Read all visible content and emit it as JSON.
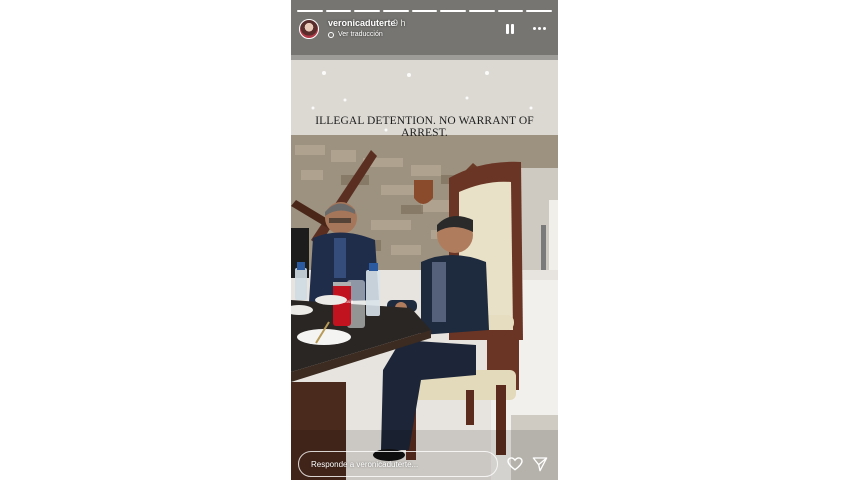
{
  "story": {
    "username": "veronicaduterte",
    "time_ago": "9 h",
    "translate_label": "Ver traducción",
    "caption": "ILLEGAL DETENTION. NO WARRANT OF ARREST.",
    "segments_total": 9,
    "segments_viewed": 9
  },
  "icons": {
    "pause": "pause-icon",
    "more": "more-options-icon",
    "like": "heart-icon",
    "share": "send-icon",
    "translate": "globe-icon"
  },
  "reply": {
    "placeholder": "Responde a veronicaduterte..."
  },
  "photo": {
    "can_label": "Coca-Cola"
  },
  "colors": {
    "story_text": "#ffffff",
    "caption_text": "#1d1d1d"
  }
}
